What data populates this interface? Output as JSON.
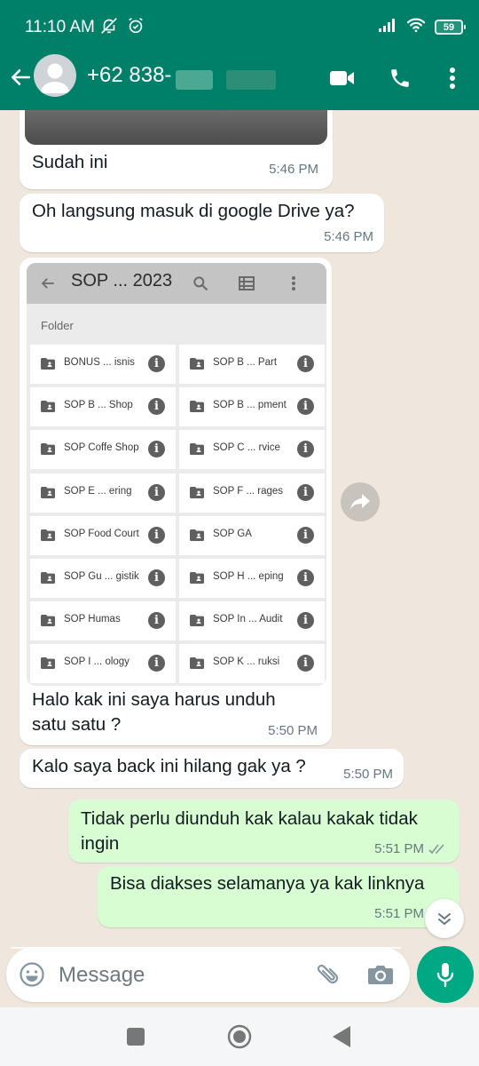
{
  "status_bar": {
    "time": "11:10 AM",
    "icons_left": [
      "mute-notifications-icon",
      "alarm-icon"
    ],
    "icons_right": [
      "signal-icon",
      "wifi-icon",
      "battery-icon"
    ],
    "battery_level": "59"
  },
  "header": {
    "contact_name": "+62 838-",
    "actions": [
      "video-call",
      "voice-call",
      "more-options"
    ],
    "background_color": "#008069"
  },
  "messages": [
    {
      "direction": "in",
      "has_image": true,
      "text": "Sudah ini",
      "time": "5:46 PM"
    },
    {
      "direction": "in",
      "text": "Oh langsung masuk di google Drive ya?",
      "time": "5:46 PM"
    },
    {
      "direction": "in",
      "has_screenshot": true,
      "text_line1": "Halo kak ini saya harus unduh",
      "text_line2": "satu satu ?",
      "time": "5:50 PM",
      "screenshot": {
        "title": "SOP ... 2023",
        "section_label": "Folder",
        "folders": [
          "BONUS ... isnis",
          "SOP B ... Part",
          "SOP B ... Shop",
          "SOP B ... pment",
          "SOP Coffe Shop",
          "SOP C ... rvice",
          "SOP E ... ering",
          "SOP F ... rages",
          "SOP Food Court",
          "SOP GA",
          "SOP Gu ... gistik",
          "SOP H ... eping",
          "SOP Humas",
          "SOP In ... Audit",
          "SOP I ... ology",
          "SOP K ... ruksi"
        ]
      }
    },
    {
      "direction": "in",
      "text": "Kalo saya back ini hilang gak ya ?",
      "time": "5:50 PM"
    },
    {
      "direction": "out",
      "text_line1": "Tidak perlu diunduh kak kalau kakak tidak",
      "text_line2": "ingin",
      "time": "5:51 PM",
      "status": "read"
    },
    {
      "direction": "out",
      "text": "Bisa diakses selamanya ya kak linknya",
      "time": "5:51 PM"
    }
  ],
  "composer": {
    "placeholder": "Message"
  },
  "colors": {
    "accent": "#00a884",
    "outgoing_bubble": "#d9fdd3",
    "incoming_bubble": "#ffffff",
    "chat_background": "#efe7dd"
  }
}
